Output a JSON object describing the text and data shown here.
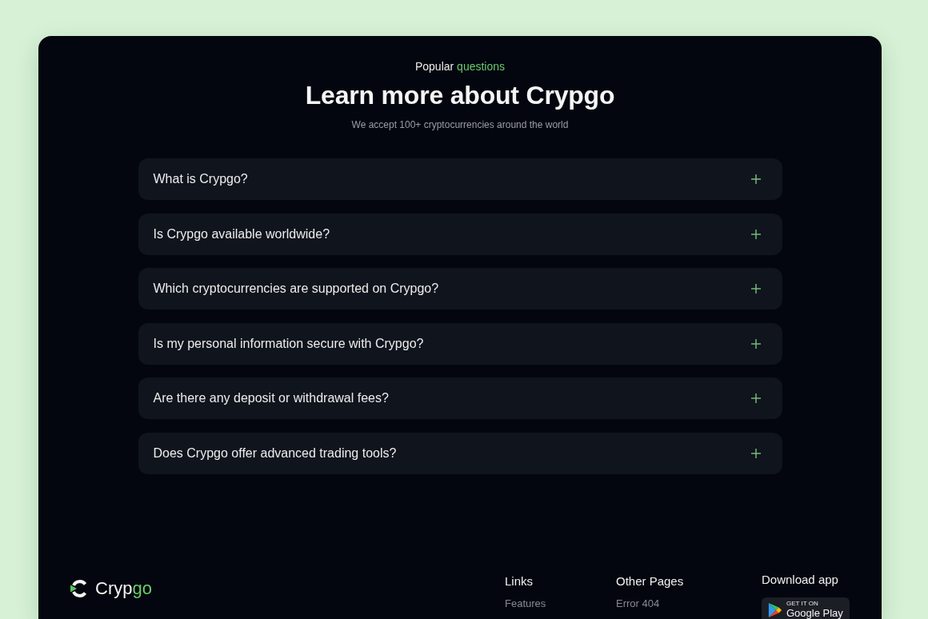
{
  "faq_header": {
    "eyebrow": "Popular",
    "eyebrow_accent": "questions",
    "title": "Learn more about Crypgo",
    "subtitle": "We accept 100+ cryptocurrencies around the world"
  },
  "faq_items": [
    {
      "question": "What is Crypgo?",
      "expanded": false
    },
    {
      "question": "Is Crypgo available worldwide?",
      "expanded": false
    },
    {
      "question": "Which cryptocurrencies are supported on Crypgo?",
      "expanded": false
    },
    {
      "question": "Is my personal information secure with Crypgo?",
      "expanded": false
    },
    {
      "question": "Are there any deposit or withdrawal fees?",
      "expanded": false
    },
    {
      "question": "Does Crypgo offer advanced trading tools?",
      "expanded": false
    }
  ],
  "footer": {
    "brand": {
      "name": "Cryp",
      "name_accent": "go"
    },
    "columns": [
      {
        "title": "Links",
        "links": [
          "Features"
        ]
      },
      {
        "title": "Other Pages",
        "links": [
          "Error 404"
        ]
      }
    ],
    "download": {
      "title": "Download app",
      "badge_small": "GET IT ON",
      "badge_large": "Google Play"
    }
  }
}
